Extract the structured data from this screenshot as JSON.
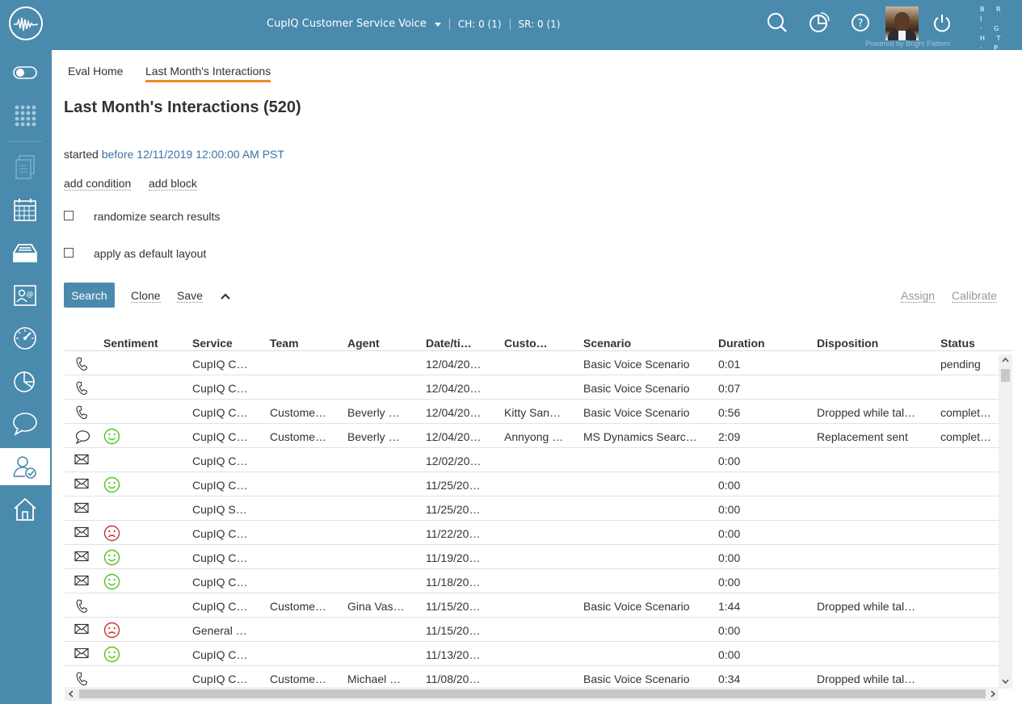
{
  "topbar": {
    "service": "CupIQ Customer Service Voice",
    "ch_status": "CH: 0 (1)",
    "sr_status": "SR: 0 (1)",
    "powered_by": "Powered by Bright Pattern",
    "brand_lines": [
      "B R I",
      "· G H T",
      "· P A T",
      "· T E R N"
    ],
    "icons": [
      "search-icon",
      "pie-chart-icon",
      "help-icon",
      "power-icon"
    ]
  },
  "sidebar": {
    "items": [
      "toggle-icon",
      "dialpad-icon",
      "documents-icon",
      "calendar-icon",
      "inbox-icon",
      "contacts-icon",
      "dashboard-icon",
      "reports-icon",
      "chat-icon",
      "qm-icon",
      "home-icon"
    ],
    "active": "qm-icon"
  },
  "tabs": {
    "eval_home": "Eval Home",
    "last_month": "Last Month's Interactions"
  },
  "page": {
    "title": "Last Month's Interactions (520)",
    "condition_label": "started",
    "condition_value": "before 12/11/2019 12:00:00 AM PST",
    "add_condition": "add condition",
    "add_block": "add block",
    "randomize": "randomize search results",
    "default_layout": "apply as default layout",
    "search": "Search",
    "clone": "Clone",
    "save": "Save",
    "assign": "Assign",
    "calibrate": "Calibrate"
  },
  "table": {
    "headers": [
      "Sentiment",
      "Service",
      "Team",
      "Agent",
      "Date/ti…",
      "Custo…",
      "Scenario",
      "Duration",
      "Disposition",
      "Status"
    ],
    "rows": [
      {
        "type": "phone",
        "sentiment": "",
        "service": "CupIQ C…",
        "team": "",
        "agent": "",
        "date": "12/04/20…",
        "customer": "",
        "scenario": "Basic Voice Scenario",
        "duration": "0:01",
        "disposition": "",
        "status": "pending"
      },
      {
        "type": "phone",
        "sentiment": "",
        "service": "CupIQ C…",
        "team": "",
        "agent": "",
        "date": "12/04/20…",
        "customer": "",
        "scenario": "Basic Voice Scenario",
        "duration": "0:07",
        "disposition": "",
        "status": ""
      },
      {
        "type": "phone",
        "sentiment": "",
        "service": "CupIQ C…",
        "team": "Custome…",
        "agent": "Beverly …",
        "date": "12/04/20…",
        "customer": "Kitty San…",
        "scenario": "Basic Voice Scenario",
        "duration": "0:56",
        "disposition": "Dropped while tal…",
        "status": "complet…"
      },
      {
        "type": "chat",
        "sentiment": "positive",
        "service": "CupIQ C…",
        "team": "Custome…",
        "agent": "Beverly …",
        "date": "12/04/20…",
        "customer": "Annyong …",
        "scenario": "MS Dynamics Searc…",
        "duration": "2:09",
        "disposition": "Replacement sent",
        "status": "complet…"
      },
      {
        "type": "email",
        "sentiment": "",
        "service": "CupIQ C…",
        "team": "",
        "agent": "",
        "date": "12/02/20…",
        "customer": "",
        "scenario": "",
        "duration": "0:00",
        "disposition": "",
        "status": ""
      },
      {
        "type": "email",
        "sentiment": "positive",
        "service": "CupIQ C…",
        "team": "",
        "agent": "",
        "date": "11/25/20…",
        "customer": "",
        "scenario": "",
        "duration": "0:00",
        "disposition": "",
        "status": ""
      },
      {
        "type": "email",
        "sentiment": "",
        "service": "CupIQ S…",
        "team": "",
        "agent": "",
        "date": "11/25/20…",
        "customer": "",
        "scenario": "",
        "duration": "0:00",
        "disposition": "",
        "status": ""
      },
      {
        "type": "email",
        "sentiment": "negative",
        "service": "CupIQ C…",
        "team": "",
        "agent": "",
        "date": "11/22/20…",
        "customer": "",
        "scenario": "",
        "duration": "0:00",
        "disposition": "",
        "status": ""
      },
      {
        "type": "email",
        "sentiment": "positive",
        "service": "CupIQ C…",
        "team": "",
        "agent": "",
        "date": "11/19/20…",
        "customer": "",
        "scenario": "",
        "duration": "0:00",
        "disposition": "",
        "status": ""
      },
      {
        "type": "email",
        "sentiment": "positive",
        "service": "CupIQ C…",
        "team": "",
        "agent": "",
        "date": "11/18/20…",
        "customer": "",
        "scenario": "",
        "duration": "0:00",
        "disposition": "",
        "status": ""
      },
      {
        "type": "phone",
        "sentiment": "",
        "service": "CupIQ C…",
        "team": "Custome…",
        "agent": "Gina Vas…",
        "date": "11/15/20…",
        "customer": "",
        "scenario": "Basic Voice Scenario",
        "duration": "1:44",
        "disposition": "Dropped while tal…",
        "status": ""
      },
      {
        "type": "email",
        "sentiment": "negative",
        "service": "General …",
        "team": "",
        "agent": "",
        "date": "11/15/20…",
        "customer": "",
        "scenario": "",
        "duration": "0:00",
        "disposition": "",
        "status": ""
      },
      {
        "type": "email",
        "sentiment": "positive",
        "service": "CupIQ C…",
        "team": "",
        "agent": "",
        "date": "11/13/20…",
        "customer": "",
        "scenario": "",
        "duration": "0:00",
        "disposition": "",
        "status": ""
      },
      {
        "type": "phone",
        "sentiment": "",
        "service": "CupIQ C…",
        "team": "Custome…",
        "agent": "Michael …",
        "date": "11/08/20…",
        "customer": "",
        "scenario": "Basic Voice Scenario",
        "duration": "0:34",
        "disposition": "Dropped while tal…",
        "status": ""
      }
    ]
  },
  "colors": {
    "accent": "#4a8aad",
    "tab_underline": "#f08a24",
    "link": "#3b73a8",
    "positive": "#52c41a",
    "negative": "#c0392b"
  }
}
